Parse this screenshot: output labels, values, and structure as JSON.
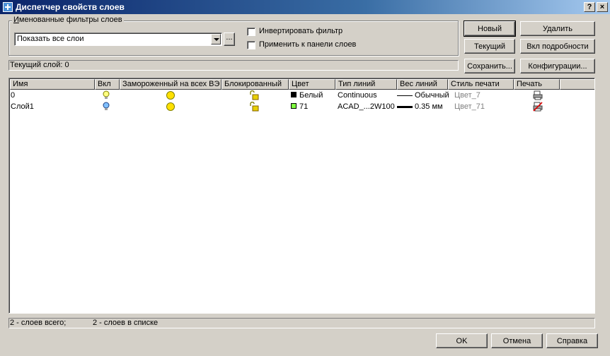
{
  "window": {
    "title": "Диспетчер свойств слоев",
    "help_button": "?",
    "close_button": "×"
  },
  "filters": {
    "group_label": "Именованные фильтры слоев",
    "combo_value": "Показать все слои",
    "browse_label": "...",
    "invert_label": "Инвертировать фильтр",
    "apply_label": "Применить к панели слоев"
  },
  "buttons": {
    "new": "Новый",
    "delete": "Удалить",
    "current": "Текущий",
    "details": "Вкл подробности",
    "save": "Сохранить...",
    "config": "Конфигурации...",
    "ok": "OK",
    "cancel": "Отмена",
    "help": "Справка"
  },
  "current_layer": "Текущий слой: 0",
  "columns": [
    "Имя",
    "Вкл",
    "Замороженный на всех ВЭ",
    "Блокированный",
    "Цвет",
    "Тип линий",
    "Вес линий",
    "Стиль печати",
    "Печать"
  ],
  "layers": [
    {
      "name": "0",
      "on": "on-bulb-icon",
      "frozen": "sun-icon",
      "locked": "unlocked-icon",
      "color_name": "Белый",
      "color_swatch": "#000000",
      "linetype": "Continuous",
      "lineweight": "Обычный",
      "plot_style": "Цвет_7",
      "plot": "printer-icon"
    },
    {
      "name": "Слой1",
      "on": "on-bulb-icon",
      "frozen": "sun-icon",
      "locked": "unlocked-icon",
      "color_name": "71",
      "color_swatch": "#7fff3f",
      "linetype": "ACAD_...2W100",
      "lineweight": "0.35 мм",
      "plot_style": "Цвет_71",
      "plot": "no-print-icon"
    }
  ],
  "status": {
    "total": "2 - слоев всего;",
    "listed": "2 - слоев в списке"
  }
}
